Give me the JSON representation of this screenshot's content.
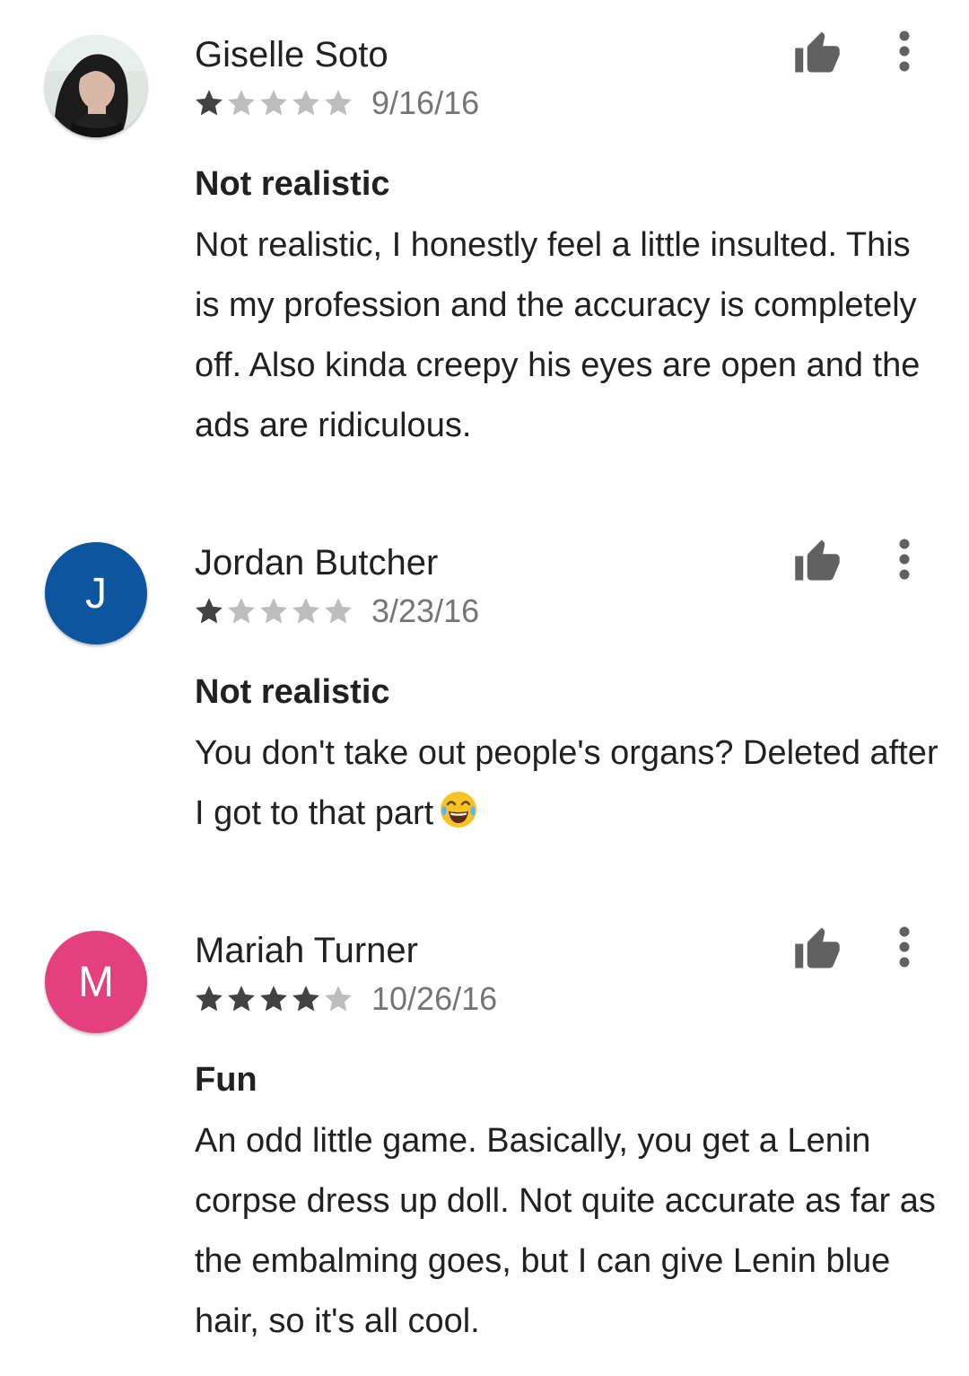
{
  "reviews": [
    {
      "name": "Giselle Soto",
      "date": "9/16/16",
      "stars": 1,
      "title": "Not realistic",
      "body": "Not realistic, I honestly feel a little insulted. This is my profession and the accuracy is completely off. Also kinda creepy his eyes are open and the ads are ridiculous.",
      "avatar_type": "photo",
      "avatar_icon": "profile-photo"
    },
    {
      "name": "Jordan Butcher",
      "date": "3/23/16",
      "stars": 1,
      "title": "Not realistic",
      "body": "You don't take out people's organs? Deleted after I got to that part",
      "body_emoji": "face-with-tears-of-joy-icon",
      "avatar_type": "initial",
      "avatar_initial": "J",
      "avatar_color": "#0D559E"
    },
    {
      "name": "Mariah Turner",
      "date": "10/26/16",
      "stars": 4,
      "title": "Fun",
      "body": "An odd little game. Basically, you get a Lenin corpse dress up doll. Not quite accurate as far as the embalming goes, but I can give Lenin blue hair, so it's all cool.",
      "avatar_type": "initial",
      "avatar_initial": "M",
      "avatar_color": "#E3407D"
    }
  ],
  "colors": {
    "star_filled": "#424242",
    "star_empty": "#bdbdbd",
    "icon": "#616161",
    "text": "#212121",
    "date": "#757575"
  },
  "icons": {
    "helpful": "thumbs-up-icon",
    "more": "more-vert-icon",
    "star": "star-icon"
  }
}
